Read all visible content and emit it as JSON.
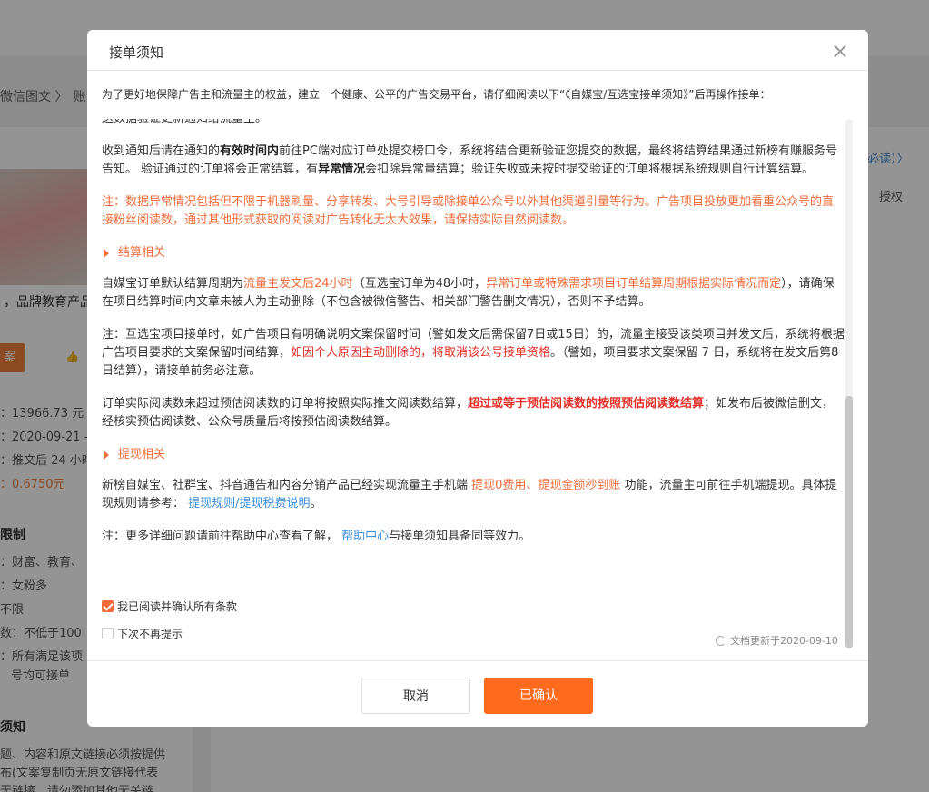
{
  "background": {
    "breadcrumb_a": "微信图文",
    "breadcrumb_sep": "〉",
    "breadcrumb_b": "账",
    "product_title": "，品牌教育产品",
    "action_btn": "案",
    "kv": [
      {
        "text": "：13966.73 元",
        "orange": false
      },
      {
        "text": "：2020-09-21 -",
        "orange": false
      },
      {
        "text": "：推文后 24 小时",
        "orange": false
      },
      {
        "text": "：0.6750元",
        "orange": true
      }
    ],
    "limit_title": "限制",
    "limits": [
      "：财富、教育、",
      "：女粉多",
      "不限",
      "数：不低于100",
      "：所有满足该项",
      "号均可接单"
    ],
    "notice_title": "须知",
    "notice_lines": [
      "题、内容和原文链接必须按提供",
      "布(文案复制页无原文链接代表",
      "无链接，请勿添加其他无关链"
    ],
    "right_link": "必读）〉",
    "auth_label": "授权"
  },
  "modal": {
    "title": "接单须知",
    "intro": "为了更好地保障广告主和流量主的权益，建立一个健康、公平的广告交易平台，请仔细阅读以下“《自媒宝/互选宝接单须知》”后再操作接单：",
    "cut_line": "送数据验证更新通知给流量主。",
    "p1": {
      "t1": "收到通知后请在通知的",
      "b1": "有效时间内",
      "t2": "前往PC端对应订单处提交榜口令，系统将结合更新验证您提交的数据，最终将结算结果通过新榜有赚服务号告知。 验证通过的订单将会正常结算，有",
      "b2": "异常情况",
      "t3": "会扣除异常量结算；验证失败或未按时提交验证的订单将根据系统规则自行计算结算。"
    },
    "note1": "注：数据异常情况包括但不限于机器刷量、分享转发、大号引导或除接单公众号以外其他渠道引量等行为。广告项目投放更加看重公众号的直接粉丝阅读数，通过其他形式获取的阅读对广告转化无太大效果，请保持实际自然阅读数。",
    "section1": "结算相关",
    "p2": {
      "t1": "自媒宝订单默认结算周期为",
      "o1": "流量主发文后24小时",
      "t2": "（互选宝订单为48小时，",
      "o2": "异常订单或特殊需求项目订单结算周期根据实际情况而定",
      "t3": "），请确保在项目结算时间内文章未被人为主动删除（不包含被微信警告、相关部门警告删文情况），否则不予结算。"
    },
    "p3": {
      "t1": "注：互选宝项目接单时，如广告项目有明确说明文案保留时间（譬如发文后需保留7日或15日）的，流量主接受该类项目并发文后，系统将根据广告项目要求的文案保留时间结算，",
      "r1": "如因个人原因主动删除的，将取消该公号接单资格",
      "t2": "。（譬如，项目要求文案保留 7 日，系统将在发文后第8日结算），请接单前务必注意。"
    },
    "p4": {
      "t1": "订单实际阅读数未超过预估阅读数的订单将按照实际推文阅读数结算，",
      "rb1": "超过或等于预估阅读数的按照预估阅读数结算",
      "t2": "；如发布后被微信删文，经核实预估阅读数、公众号质量后将按预估阅读数结算。"
    },
    "section2": "提现相关",
    "p5": {
      "t1": "新榜自媒宝、社群宝、抖音通告和内容分销产品已经实现流量主手机端 ",
      "o1": "提现0费用、提现金额秒到账",
      "t2": " 功能，流量主可前往手机端提现。具体提现规则请参考： ",
      "link": "提现规则/提现税费说明",
      "t3": "。"
    },
    "p6": {
      "t1": "注：更多详细问题请前往帮助中心查看了解， ",
      "link": "帮助中心",
      "t2": "与接单须知具备同等效力。"
    },
    "checkbox_agree": "我已阅读并确认所有条款",
    "checkbox_agree_checked": true,
    "checkbox_hide": "下次不再提示",
    "checkbox_hide_checked": false,
    "update_text": "文档更新于2020-09-10",
    "cancel_label": "取消",
    "confirm_label": "已确认"
  },
  "colors": {
    "accent": "#ff6a1c",
    "note_orange": "#f26b3a",
    "emphasis_red": "#e5302a",
    "link_blue": "#3b8fd9"
  }
}
